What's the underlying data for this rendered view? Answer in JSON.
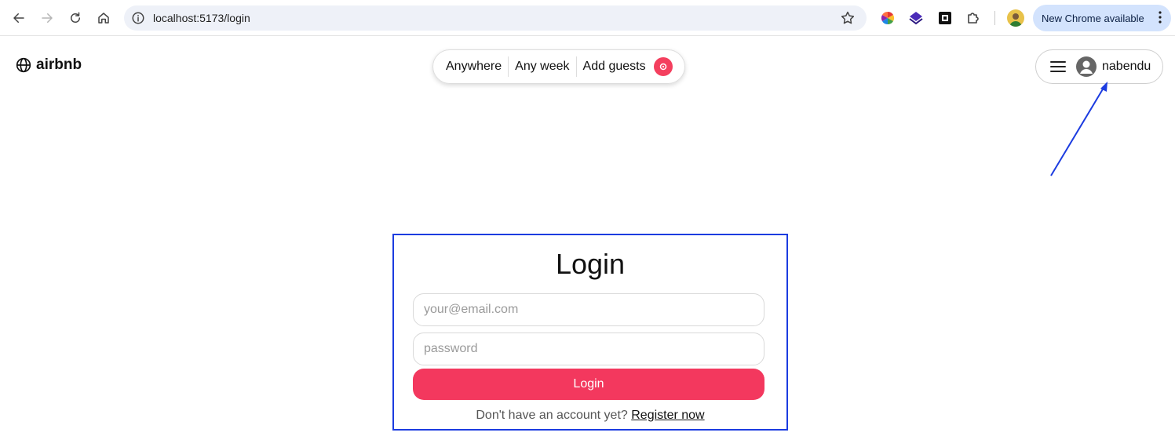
{
  "browser": {
    "url": "localhost:5173/login",
    "update_label": "New Chrome available"
  },
  "header": {
    "brand": "airbnb",
    "search": {
      "where": "Anywhere",
      "when": "Any week",
      "who": "Add guests"
    },
    "user": {
      "name": "nabendu"
    }
  },
  "login": {
    "title": "Login",
    "email_placeholder": "your@email.com",
    "password_placeholder": "password",
    "submit_label": "Login",
    "register_prompt": "Don't have an account yet?",
    "register_link": "Register now"
  },
  "colors": {
    "brand": "#f43f5e",
    "button": "#f3385e",
    "annotation": "#1c3ce0"
  }
}
